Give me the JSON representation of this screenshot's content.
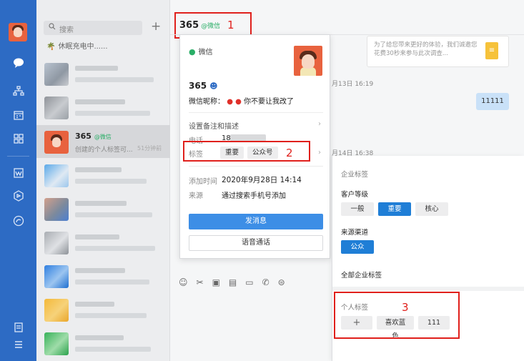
{
  "sidebar": {
    "icons": [
      "chat-icon",
      "org-icon",
      "calendar-icon",
      "apps-icon",
      "workbench-icon",
      "miniprogram-icon",
      "disk-icon",
      "notes-icon",
      "menu-icon"
    ]
  },
  "chat_list": {
    "search_placeholder": "搜索",
    "add_label": "+",
    "status_text": "休眠充电中......",
    "selected": {
      "name": "365",
      "source": "@微信",
      "preview": "创建的个人标签可...",
      "time": "51分钟前"
    }
  },
  "chat": {
    "title": "365",
    "title_source": "@微信",
    "tip_text": "为了给您带来更好的体验，我们诚邀您花费30秒来参与此次调查...",
    "timestamp_1": "月13日 16:19",
    "message": "11111",
    "timestamp_2": "月14日 16:38"
  },
  "annotations": {
    "one": "1",
    "two": "2",
    "three": "3"
  },
  "profile": {
    "source": "微信",
    "name": "365",
    "nickname_label": "微信昵称：",
    "nickname_value": "你不要让我改了",
    "remark_label": "设置备注和描述",
    "phone_label": "电话",
    "phone_value": "18",
    "tags_label": "标签",
    "tags": [
      "重要",
      "公众号"
    ],
    "added_time_label": "添加时间",
    "added_time_value": "2020年9月28日 14:14",
    "origin_label": "来源",
    "origin_value": "通过搜索手机号添加",
    "send_label": "发消息",
    "voice_label": "语音通话"
  },
  "tag_panel": {
    "title": "企业标签",
    "group_level": "客户等级",
    "level_options": [
      {
        "label": "一般",
        "active": false
      },
      {
        "label": "重要",
        "active": true
      },
      {
        "label": "核心",
        "active": false
      }
    ],
    "group_channel": "来源渠道",
    "channel_options": [
      {
        "label": "公众号",
        "active": true
      }
    ],
    "all_tags": "全部企业标签",
    "personal_title": "个人标签",
    "personal_add": "+",
    "personal_tags": [
      "喜欢蓝色",
      "111"
    ]
  },
  "colors": {
    "rail": "#2d6bc4",
    "accent": "#1f7ed6",
    "annotation": "#e0201c",
    "wechat_green": "#2aae67"
  }
}
